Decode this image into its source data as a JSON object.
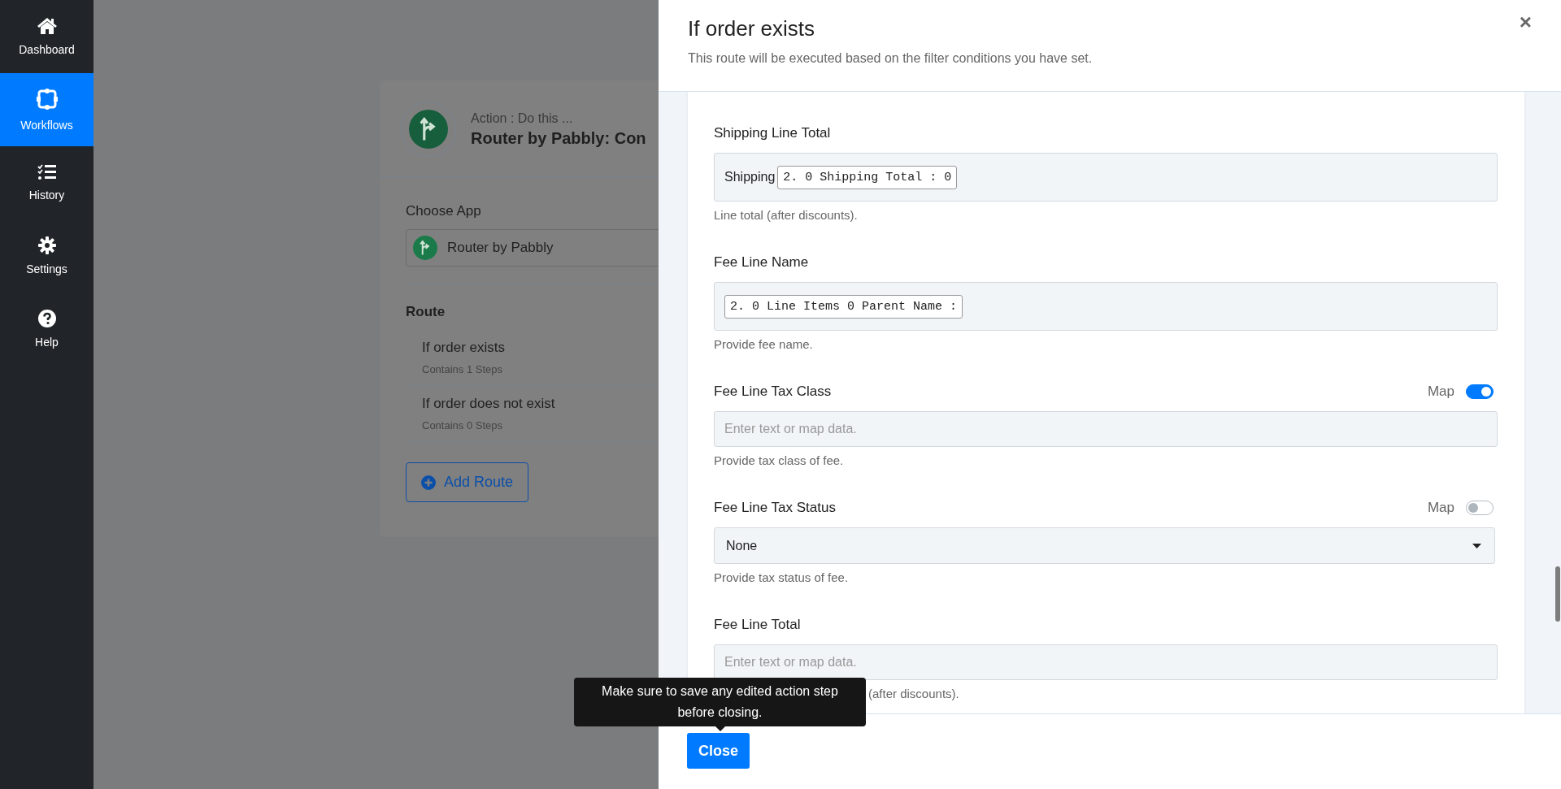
{
  "sidebar": {
    "items": [
      {
        "label": "Dashboard",
        "selected": false
      },
      {
        "label": "Workflows",
        "selected": true
      },
      {
        "label": "History",
        "selected": false
      },
      {
        "label": "Settings",
        "selected": false
      },
      {
        "label": "Help",
        "selected": false
      }
    ]
  },
  "card": {
    "action_label": "Action : Do this ...",
    "title": "Router by Pabbly: Con",
    "choose_app": {
      "label": "Choose App",
      "value": "Router by Pabbly"
    },
    "route": {
      "heading": "Route",
      "items": [
        {
          "name": "If order exists",
          "steps": "Contains 1 Steps"
        },
        {
          "name": "If order does not exist",
          "steps": "Contains 0 Steps"
        }
      ]
    },
    "add_button": "Add Route"
  },
  "panel": {
    "title": "If order exists",
    "subtitle": "This route will be executed based on the filter conditions you have set.",
    "close_icon": "×",
    "fields": [
      {
        "kind": "chips",
        "label": "Shipping Line Total",
        "prefix": "Shipping",
        "chip": "2. 0 Shipping Total : 0",
        "help": "Line total (after discounts)."
      },
      {
        "kind": "chips",
        "label": "Fee Line Name",
        "chip": "2. 0 Line Items 0 Parent Name :",
        "help": "Provide fee name."
      },
      {
        "kind": "input",
        "label": "Fee Line Tax Class",
        "map": {
          "label": "Map",
          "on": true
        },
        "placeholder": "Enter text or map data.",
        "help": "Provide tax class of fee."
      },
      {
        "kind": "select",
        "label": "Fee Line Tax Status",
        "map": {
          "label": "Map",
          "on": false
        },
        "value": "None",
        "help": "Provide tax status of fee."
      },
      {
        "kind": "input",
        "label": "Fee Line Total",
        "placeholder": "Enter text or map data.",
        "help": "(after discounts)."
      }
    ],
    "close_button": "Close",
    "tooltip": "Make sure to save any edited action step before closing."
  }
}
